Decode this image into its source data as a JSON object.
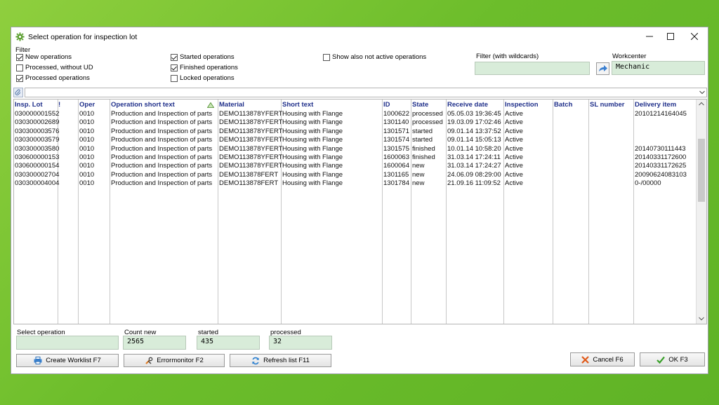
{
  "window": {
    "title": "Select operation for inspection lot",
    "controls": [
      "minimize",
      "maximize",
      "close"
    ]
  },
  "filter": {
    "group_label": "Filter",
    "checkboxes": [
      {
        "label": "New operations",
        "checked": true
      },
      {
        "label": "Processed, without UD",
        "checked": false
      },
      {
        "label": "Processed operations",
        "checked": true
      },
      {
        "label": "Started operations",
        "checked": true
      },
      {
        "label": "Finished operations",
        "checked": true
      },
      {
        "label": "Locked operations",
        "checked": false
      },
      {
        "label": "Show also not active operations",
        "checked": false
      }
    ],
    "wildcard_label": "Filter (with wildcards)",
    "wildcard_value": "",
    "workcenter_label": "Workcenter",
    "workcenter_value": "Mechanic"
  },
  "table": {
    "columns": [
      "Insp. Lot",
      "!",
      "Oper",
      "Operation short text",
      "Material",
      "Short text",
      "ID",
      "State",
      "Receive date",
      "Inspection",
      "Batch",
      "SL number",
      "Delivery item"
    ],
    "rows": [
      [
        "030000001552",
        "",
        "0010",
        "Production and Inspection of parts",
        "DEMO113878YFERT",
        "Housing with Flange",
        "1000622",
        "processed",
        "05.05.03 19:36:45",
        "Active",
        "",
        "",
        "20101214164045"
      ],
      [
        "030300002689",
        "",
        "0010",
        "Production and Inspection of parts",
        "DEMO113878YFERT",
        "Housing with Flange",
        "1301140",
        "processed",
        "19.03.09 17:02:46",
        "Active",
        "",
        "",
        ""
      ],
      [
        "030300003576",
        "",
        "0010",
        "Production and Inspection of parts",
        "DEMO113878YFERT",
        "Housing with Flange",
        "1301571",
        "started",
        "09.01.14 13:37:52",
        "Active",
        "",
        "",
        ""
      ],
      [
        "030300003579",
        "",
        "0010",
        "Production and Inspection of parts",
        "DEMO113878YFERT",
        "Housing with Flange",
        "1301574",
        "started",
        "09.01.14 15:05:13",
        "Active",
        "",
        "",
        ""
      ],
      [
        "030300003580",
        "",
        "0010",
        "Production and Inspection of parts",
        "DEMO113878YFERT",
        "Housing with Flange",
        "1301575",
        "finished",
        "10.01.14 10:58:20",
        "Active",
        "",
        "",
        "20140730111443"
      ],
      [
        "030600000153",
        "",
        "0010",
        "Production and Inspection of parts",
        "DEMO113878YFERT",
        "Housing with Flange",
        "1600063",
        "finished",
        "31.03.14 17:24:11",
        "Active",
        "",
        "",
        "20140331172600"
      ],
      [
        "030600000154",
        "",
        "0010",
        "Production and Inspection of parts",
        "DEMO113878YFERT",
        "Housing with Flange",
        "1600064",
        "new",
        "31.03.14 17:24:27",
        "Active",
        "",
        "",
        "20140331172625"
      ],
      [
        "030300002704",
        "",
        "0010",
        "Production and Inspection of parts",
        "DEMO113878FERT",
        "Housing with Flange",
        "1301165",
        "new",
        "24.06.09 08:29:00",
        "Active",
        "",
        "",
        "20090624083103"
      ],
      [
        "030300004004",
        "",
        "0010",
        "Production and Inspection of parts",
        "DEMO113878FERT",
        "Housing with Flange",
        "1301784",
        "new",
        "21.09.16 11:09:52",
        "Active",
        "",
        "",
        "0-/00000"
      ]
    ]
  },
  "summary": {
    "select_label": "Select operation",
    "select_value": "",
    "count_new_label": "Count new",
    "count_new_value": "2565",
    "started_label": "started",
    "started_value": "435",
    "processed_label": "processed",
    "processed_value": "32"
  },
  "buttons": {
    "create_worklist": "Create Worklist  F7",
    "errormonitor": "Errormonitor  F2",
    "refresh": "Refresh list  F11",
    "cancel": "Cancel  F6",
    "ok": "OK  F3"
  }
}
